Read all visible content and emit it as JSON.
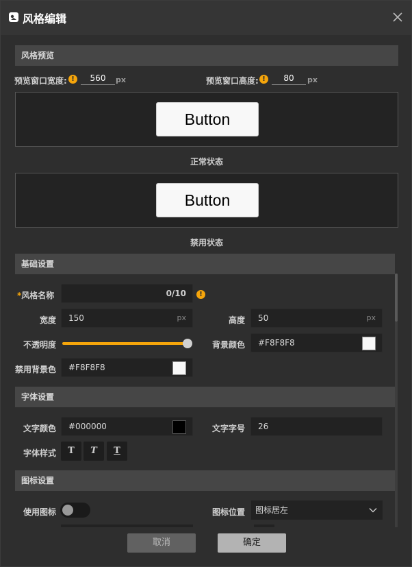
{
  "dialog": {
    "title": "风格编辑"
  },
  "preview_section": {
    "heading": "风格预览",
    "width_label": "预览窗口宽度:",
    "width_value": "560",
    "width_unit": "px",
    "height_label": "预览窗口高度:",
    "height_value": "80",
    "height_unit": "px",
    "normal_button_text": "Button",
    "normal_caption": "正常状态",
    "disabled_button_text": "Button",
    "disabled_caption": "禁用状态"
  },
  "basic_section": {
    "heading": "基础设置",
    "required_mark": "*",
    "name_label": "风格名称",
    "name_value": "",
    "name_counter": "0/10",
    "width_label": "宽度",
    "width_value": "150",
    "width_unit": "px",
    "height_label": "高度",
    "height_value": "50",
    "height_unit": "px",
    "opacity_label": "不透明度",
    "opacity_value": 1.0,
    "bg_color_label": "背景颜色",
    "bg_color_value": "#F8F8F8",
    "disabled_bg_label": "禁用背景色",
    "disabled_bg_value": "#F8F8F8"
  },
  "font_section": {
    "heading": "字体设置",
    "text_color_label": "文字颜色",
    "text_color_value": "#000000",
    "font_size_label": "文字字号",
    "font_size_value": "26",
    "font_style_label": "字体样式",
    "style_buttons": [
      {
        "glyph": "T",
        "name": "bold-icon"
      },
      {
        "glyph": "T",
        "name": "italic-icon"
      },
      {
        "glyph": "T",
        "name": "underline-icon"
      }
    ]
  },
  "icon_section": {
    "heading": "图标设置",
    "use_icon_label": "使用图标",
    "use_icon_enabled": false,
    "position_label": "图标位置",
    "position_value": "图标居左"
  },
  "footer": {
    "cancel_label": "取消",
    "ok_label": "确定"
  },
  "colors": {
    "accent": "#F5A50B",
    "background": "#2E2E2E",
    "section_header": "#464646"
  }
}
